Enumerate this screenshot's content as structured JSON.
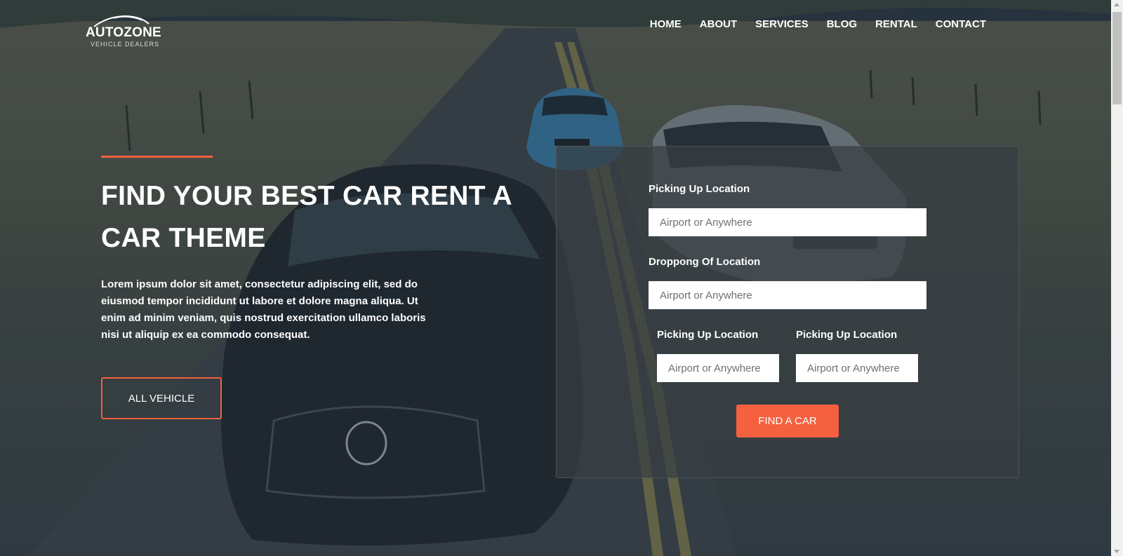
{
  "brand": {
    "name": "AUTOZONE",
    "tagline": "VEHICLE DEALERS"
  },
  "nav": {
    "items": [
      {
        "label": "HOME"
      },
      {
        "label": "ABOUT"
      },
      {
        "label": "SERVICES"
      },
      {
        "label": "BLOG"
      },
      {
        "label": "RENTAL"
      },
      {
        "label": "CONTACT"
      }
    ]
  },
  "hero": {
    "title": "FIND YOUR BEST CAR RENT A CAR THEME",
    "description": "Lorem ipsum dolor sit amet, consectetur adipiscing elit, sed do eiusmod tempor incididunt ut labore et dolore magna aliqua. Ut enim ad minim veniam, quis nostrud exercitation ullamco laboris nisi ut aliquip ex ea commodo consequat.",
    "button_label": "ALL VEHICLE"
  },
  "booking": {
    "pickup_label": "Picking Up Location",
    "pickup_placeholder": "Airport or Anywhere",
    "dropoff_label": "Droppong Of Location",
    "dropoff_placeholder": "Airport or Anywhere",
    "small_left_label": "Picking Up Location",
    "small_left_placeholder": "Airport or Anywhere",
    "small_right_label": "Picking Up Location",
    "small_right_placeholder": "Airport or Anywhere",
    "submit_label": "FIND A CAR"
  },
  "colors": {
    "accent": "#f0613d",
    "button": "#f5603f",
    "panel": "#373e42"
  }
}
